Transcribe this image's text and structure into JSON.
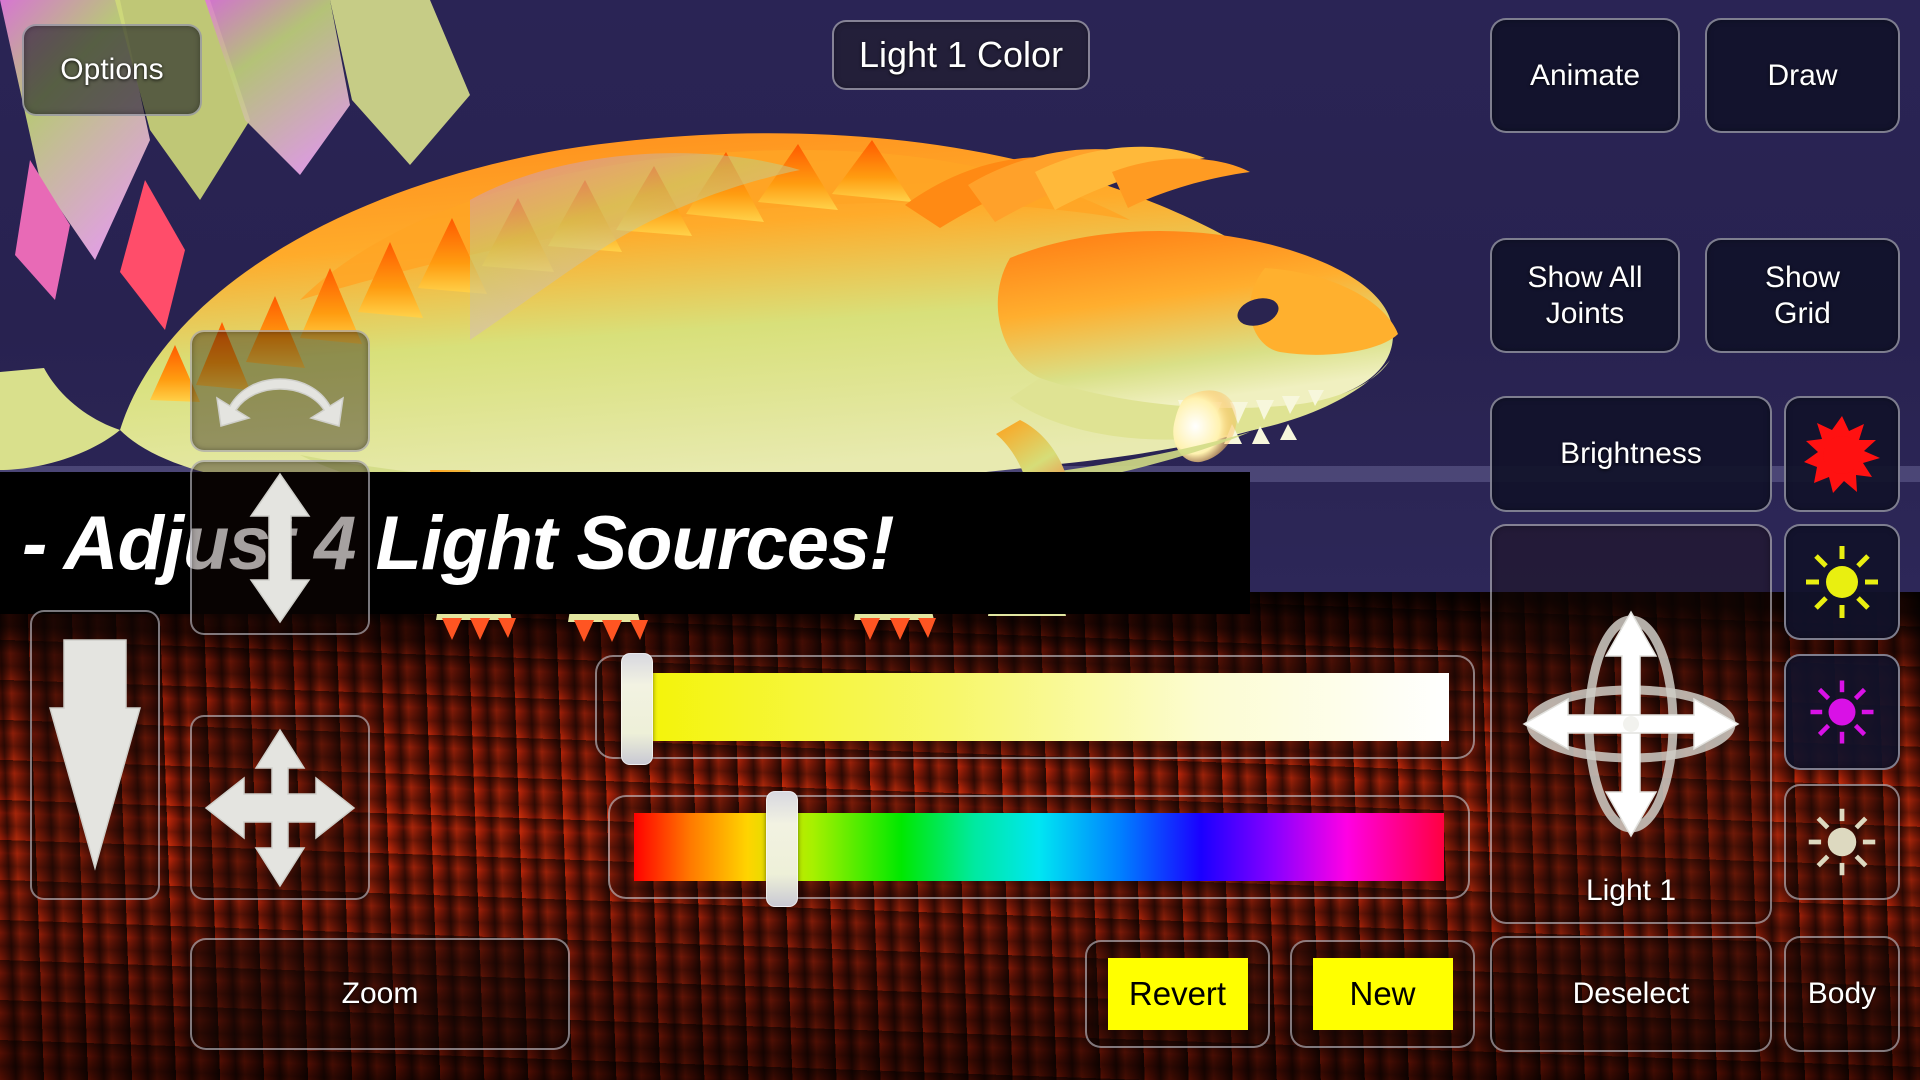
{
  "app": {
    "banner_text": "- Adjust 4 Light Sources!",
    "title_overlay": "Light 1 Color"
  },
  "top_left": {
    "options_label": "Options"
  },
  "right_panel": {
    "animate_label": "Animate",
    "draw_label": "Draw",
    "show_all_joints_label": "Show All\nJoints",
    "show_all_joints_line1": "Show All",
    "show_all_joints_line2": "Joints",
    "show_grid_line1": "Show",
    "show_grid_line2": "Grid",
    "brightness_label": "Brightness",
    "light_selector_label": "Light 1",
    "deselect_label": "Deselect",
    "body_label": "Body",
    "light_icons": [
      {
        "name": "light-1",
        "style": "solid-spiky",
        "color": "#ff1111"
      },
      {
        "name": "light-2",
        "style": "ray-lines",
        "color": "#e9ef10"
      },
      {
        "name": "light-3",
        "style": "ray-lines",
        "color": "#d911e6"
      },
      {
        "name": "light-4",
        "style": "ray-lines",
        "color": "#ddd9c0"
      }
    ]
  },
  "left_controls": {
    "rotate_icon": "curved-double-arrow-icon",
    "up_down_icon": "vertical-double-arrow-icon",
    "down_icon": "down-arrow-icon",
    "move_icon": "four-way-move-icon",
    "zoom_label": "Zoom"
  },
  "sliders": {
    "saturation": {
      "name": "saturation-slider",
      "value_percent": 0,
      "gradient_from": "#f4f400",
      "gradient_to": "#ffffff"
    },
    "hue": {
      "name": "hue-slider",
      "value_percent": 17,
      "gradient_stops": [
        "#ff0000",
        "#ffd400",
        "#00e800",
        "#00e6f2",
        "#1a00ff",
        "#ff00e4",
        "#ff0040"
      ]
    }
  },
  "actions": {
    "revert_label": "Revert",
    "new_label": "New",
    "swatch_color": "#ffff00"
  },
  "theme": {
    "sky_color": "#282250",
    "ground_color": "#a33c15",
    "button_border": "#d7d7e1",
    "button_fill": "#11122a",
    "text_color": "#ffffff"
  }
}
